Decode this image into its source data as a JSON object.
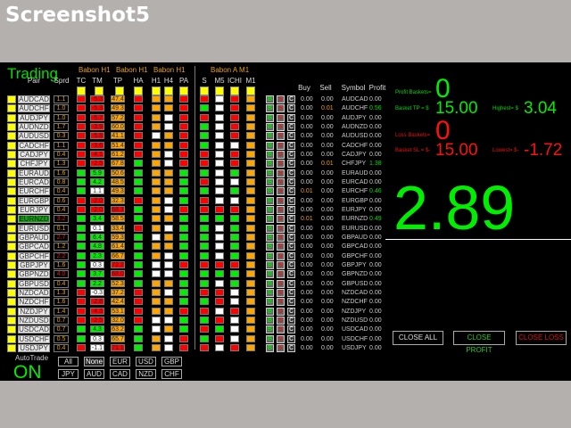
{
  "window_title": "Screenshot5",
  "colors": {
    "red": "#ff0000",
    "orange": "#ffa500",
    "green": "#00ee00",
    "white": "#ffffff",
    "yellow": "#ffff00",
    "accent_green": "#00dd00",
    "loss_red": "#ff1010"
  },
  "trading_label": "Trading",
  "group_headers": [
    "Babon H1",
    "Babon H1",
    "Babon H1",
    "Babon A M1"
  ],
  "columns": {
    "pair": "Pair",
    "sprd": "Sprd",
    "tc": "TC",
    "tm": "TM",
    "tp": "TP",
    "ha": "HA",
    "h1": "H1",
    "h4": "H4",
    "pa": "PA",
    "s": "S",
    "m5": "M5",
    "ichi": "ICHI",
    "m1": "M1",
    "buy": "Buy",
    "sell": "Sell",
    "symbol": "Symbol",
    "profit": "Profit"
  },
  "trade_buttons": {
    "buy": "B",
    "sell": "S",
    "close": "C"
  },
  "rows": [
    {
      "pair": "AUDCAD",
      "sprd": "1.1",
      "sc": "orange",
      "tc": "red",
      "tm": "-5.3",
      "tmc": "red",
      "tp": "47.4",
      "tpc": "orange",
      "sig": [
        "red",
        "orange",
        "orange",
        "red",
        "red",
        "white",
        "red",
        "orange"
      ],
      "buy": "0.00",
      "sell": "0.00",
      "profit": "0.00"
    },
    {
      "pair": "AUDCHF",
      "sprd": "1.0",
      "sc": "orange",
      "tc": "red",
      "tm": "-5.3",
      "tmc": "red",
      "tp": "49.3",
      "tpc": "orange",
      "sig": [
        "red",
        "orange",
        "orange",
        "red",
        "green",
        "white",
        "red",
        "orange"
      ],
      "buy": "0.00",
      "sell": "0.01",
      "profit": "0.56"
    },
    {
      "pair": "AUDJPY",
      "sprd": "1.0",
      "sc": "orange",
      "tc": "red",
      "tm": "-5.7",
      "tmc": "red",
      "tp": "57.2",
      "tpc": "orange",
      "sig": [
        "red",
        "orange",
        "white",
        "red",
        "red",
        "white",
        "red",
        "orange"
      ],
      "buy": "0.00",
      "sell": "0.00",
      "profit": "0.00"
    },
    {
      "pair": "AUDNZD",
      "sprd": "1.7",
      "sc": "orange",
      "tc": "red",
      "tm": "-3.9",
      "tmc": "red",
      "tp": "60.0",
      "tpc": "orange",
      "sig": [
        "red",
        "orange",
        "white",
        "red",
        "green",
        "white",
        "red",
        "orange"
      ],
      "buy": "0.00",
      "sell": "0.00",
      "profit": "0.00"
    },
    {
      "pair": "AUDUSD",
      "sprd": "0.3",
      "sc": "orange",
      "tc": "red",
      "tm": "-5.8",
      "tmc": "red",
      "tp": "41.1",
      "tpc": "orange",
      "sig": [
        "red",
        "white",
        "orange",
        "red",
        "green",
        "white",
        "red",
        "orange"
      ],
      "buy": "0.00",
      "sell": "0.00",
      "profit": "0.00"
    },
    {
      "pair": "CADCHF",
      "sprd": "1.1",
      "sc": "orange",
      "tc": "red",
      "tm": "-3.6",
      "tmc": "red",
      "tp": "51.4",
      "tpc": "orange",
      "sig": [
        "red",
        "orange",
        "orange",
        "red",
        "green",
        "white",
        "white",
        "orange"
      ],
      "buy": "0.00",
      "sell": "0.00",
      "profit": "0.00"
    },
    {
      "pair": "CADJPY",
      "sprd": "0.4",
      "sc": "orange",
      "tc": "red",
      "tm": "-4.1",
      "tmc": "red",
      "tp": "61.2",
      "tpc": "orange",
      "sig": [
        "red",
        "orange",
        "white",
        "red",
        "red",
        "white",
        "red",
        "orange"
      ],
      "buy": "0.00",
      "sell": "0.00",
      "profit": "0.00"
    },
    {
      "pair": "CHFJPY",
      "sprd": "1.3",
      "sc": "orange",
      "tc": "red",
      "tm": "-2.5",
      "tmc": "red",
      "tp": "67.8",
      "tpc": "orange",
      "sig": [
        "green",
        "orange",
        "white",
        "red",
        "red",
        "white",
        "red",
        "orange"
      ],
      "buy": "0.00",
      "sell": "0.01",
      "profit": "1.38"
    },
    {
      "pair": "EURAUD",
      "sprd": "1.6",
      "sc": "orange",
      "tc": "green",
      "tm": "5.9",
      "tmc": "green",
      "tp": "50.6",
      "tpc": "orange",
      "sig": [
        "green",
        "orange",
        "orange",
        "green",
        "green",
        "white",
        "green",
        "orange"
      ],
      "buy": "0.00",
      "sell": "0.00",
      "profit": "0.00"
    },
    {
      "pair": "EURCAD",
      "sprd": "0.8",
      "sc": "orange",
      "tc": "green",
      "tm": "4.2",
      "tmc": "green",
      "tp": "48.5",
      "tpc": "orange",
      "sig": [
        "green",
        "orange",
        "orange",
        "green",
        "red",
        "white",
        "white",
        "orange"
      ],
      "buy": "0.00",
      "sell": "0.00",
      "profit": "0.00"
    },
    {
      "pair": "EURCHF",
      "sprd": "0.4",
      "sc": "orange",
      "tc": "green",
      "tm": "1.1",
      "tmc": "white",
      "tp": "49.3",
      "tpc": "orange",
      "sig": [
        "green",
        "orange",
        "orange",
        "green",
        "green",
        "white",
        "green",
        "orange"
      ],
      "buy": "0.01",
      "sell": "0.00",
      "profit": "0.46"
    },
    {
      "pair": "EURGBP",
      "sprd": "0.6",
      "sc": "orange",
      "tc": "red",
      "tm": "-2.0",
      "tmc": "red",
      "tp": "32.3",
      "tpc": "orange",
      "sig": [
        "red",
        "orange",
        "white",
        "green",
        "red",
        "white",
        "white",
        "orange"
      ],
      "buy": "0.00",
      "sell": "0.00",
      "profit": "0.00"
    },
    {
      "pair": "EURJPY",
      "sprd": "0.4",
      "sc": "orange",
      "tc": "red",
      "tm": "-2.0",
      "tmc": "red",
      "tp": "68.3",
      "tpc": "red",
      "sig": [
        "green",
        "orange",
        "white",
        "red",
        "red",
        "red",
        "red",
        "orange"
      ],
      "buy": "0.00",
      "sell": "0.00",
      "profit": "0.00"
    },
    {
      "pair": "EURNZD",
      "sprd": "3.2",
      "sc": "red",
      "tc": "green",
      "tm": "3.4",
      "tmc": "green",
      "tp": "58.5",
      "tpc": "orange",
      "sig": [
        "green",
        "orange",
        "orange",
        "green",
        "green",
        "green",
        "green",
        "orange"
      ],
      "buy": "0.01",
      "sell": "0.00",
      "profit": "0.49",
      "selected": true
    },
    {
      "pair": "EURUSD",
      "sprd": "0.1",
      "sc": "orange",
      "tc": "green",
      "tm": "0.1",
      "tmc": "white",
      "tp": "33.4",
      "tpc": "orange",
      "sig": [
        "red",
        "orange",
        "white",
        "green",
        "green",
        "white",
        "green",
        "orange"
      ],
      "buy": "0.00",
      "sell": "0.00",
      "profit": "0.00"
    },
    {
      "pair": "GBPAUD",
      "sprd": "2.7",
      "sc": "red",
      "tc": "green",
      "tm": "6.4",
      "tmc": "green",
      "tp": "59.3",
      "tpc": "orange",
      "sig": [
        "green",
        "white",
        "orange",
        "green",
        "green",
        "white",
        "green",
        "orange"
      ],
      "buy": "0.00",
      "sell": "0.00",
      "profit": "0.00"
    },
    {
      "pair": "GBPCAD",
      "sprd": "1.2",
      "sc": "orange",
      "tc": "green",
      "tm": "4.8",
      "tmc": "green",
      "tp": "61.4",
      "tpc": "orange",
      "sig": [
        "green",
        "orange",
        "orange",
        "green",
        "green",
        "white",
        "green",
        "orange"
      ],
      "buy": "0.00",
      "sell": "0.00",
      "profit": "0.00"
    },
    {
      "pair": "GBPCHF",
      "sprd": "2.2",
      "sc": "red",
      "tc": "green",
      "tm": "2.3",
      "tmc": "green",
      "tp": "66.7",
      "tpc": "orange",
      "sig": [
        "green",
        "orange",
        "white",
        "green",
        "green",
        "white",
        "green",
        "orange"
      ],
      "buy": "0.00",
      "sell": "0.00",
      "profit": "0.00"
    },
    {
      "pair": "GBPJPY",
      "sprd": "1.6",
      "sc": "orange",
      "tc": "green",
      "tm": "0.3",
      "tmc": "white",
      "tp": "72.2",
      "tpc": "red",
      "sig": [
        "green",
        "white",
        "white",
        "red",
        "red",
        "red",
        "red",
        "orange"
      ],
      "buy": "0.00",
      "sell": "0.00",
      "profit": "0.00"
    },
    {
      "pair": "GBPNZD",
      "sprd": "4.0",
      "sc": "red",
      "tc": "green",
      "tm": "3.7",
      "tmc": "green",
      "tp": "68.0",
      "tpc": "red",
      "sig": [
        "green",
        "white",
        "white",
        "green",
        "green",
        "green",
        "green",
        "orange"
      ],
      "buy": "0.00",
      "sell": "0.00",
      "profit": "0.00"
    },
    {
      "pair": "GBPUSD",
      "sprd": "0.4",
      "sc": "orange",
      "tc": "green",
      "tm": "2.2",
      "tmc": "green",
      "tp": "52.3",
      "tpc": "orange",
      "sig": [
        "green",
        "orange",
        "orange",
        "green",
        "green",
        "white",
        "green",
        "orange"
      ],
      "buy": "0.00",
      "sell": "0.00",
      "profit": "0.00"
    },
    {
      "pair": "NZDCAD",
      "sprd": "1.3",
      "sc": "orange",
      "tc": "red",
      "tm": "-0.3",
      "tmc": "white",
      "tp": "37.2",
      "tpc": "orange",
      "sig": [
        "red",
        "orange",
        "white",
        "green",
        "red",
        "red",
        "white",
        "orange"
      ],
      "buy": "0.00",
      "sell": "0.00",
      "profit": "0.00"
    },
    {
      "pair": "NZDCHF",
      "sprd": "1.6",
      "sc": "orange",
      "tc": "red",
      "tm": "-2.8",
      "tmc": "red",
      "tp": "42.4",
      "tpc": "orange",
      "sig": [
        "red",
        "orange",
        "orange",
        "green",
        "green",
        "red",
        "white",
        "orange"
      ],
      "buy": "0.00",
      "sell": "0.00",
      "profit": "0.00"
    },
    {
      "pair": "NZDJPY",
      "sprd": "1.4",
      "sc": "orange",
      "tc": "red",
      "tm": "-4.3",
      "tmc": "red",
      "tp": "53.1",
      "tpc": "orange",
      "sig": [
        "red",
        "orange",
        "orange",
        "red",
        "red",
        "white",
        "red",
        "orange"
      ],
      "buy": "0.00",
      "sell": "0.00",
      "profit": "0.00"
    },
    {
      "pair": "NZDUSD",
      "sprd": "0.7",
      "sc": "orange",
      "tc": "red",
      "tm": "-2.5",
      "tmc": "red",
      "tp": "32.0",
      "tpc": "orange",
      "sig": [
        "red",
        "white",
        "white",
        "green",
        "green",
        "red",
        "white",
        "orange"
      ],
      "buy": "0.00",
      "sell": "0.00",
      "profit": "0.00"
    },
    {
      "pair": "USDCAD",
      "sprd": "0.7",
      "sc": "orange",
      "tc": "green",
      "tm": "4.3",
      "tmc": "green",
      "tp": "63.2",
      "tpc": "orange",
      "sig": [
        "green",
        "white",
        "orange",
        "green",
        "red",
        "green",
        "white",
        "orange"
      ],
      "buy": "0.00",
      "sell": "0.00",
      "profit": "0.00"
    },
    {
      "pair": "USDCHF",
      "sprd": "0.5",
      "sc": "orange",
      "tc": "green",
      "tm": "0.3",
      "tmc": "white",
      "tp": "65.7",
      "tpc": "orange",
      "sig": [
        "green",
        "orange",
        "white",
        "red",
        "green",
        "red",
        "white",
        "orange"
      ],
      "buy": "0.00",
      "sell": "0.00",
      "profit": "0.00"
    },
    {
      "pair": "USDJPY",
      "sprd": "0.4",
      "sc": "orange",
      "tc": "red",
      "tm": "-1.1",
      "tmc": "white",
      "tp": "71.1",
      "tpc": "red",
      "sig": [
        "green",
        "orange",
        "white",
        "red",
        "red",
        "white",
        "red",
        "orange"
      ],
      "buy": "0.00",
      "sell": "0.00",
      "profit": "0.00"
    }
  ],
  "summary": {
    "profit_baskets_label": "Profit Baskets=",
    "profit_baskets": "0",
    "basket_tp_label": "Basket TP = $",
    "basket_tp": "15.00",
    "highest_label": "Highest= $",
    "highest": "3.04",
    "loss_baskets_label": "Loss Baskets=",
    "loss_baskets": "0",
    "basket_sl_label": "Basket SL = $-",
    "basket_sl": "15.00",
    "lowest_label": "Lowest= $-",
    "lowest": "-1.72",
    "total_profit": "2.89"
  },
  "actions": {
    "close_all": "CLOSE ALL",
    "close_profit": "CLOSE PROFIT",
    "close_loss": "CLOSE LOSS"
  },
  "autotrade": {
    "label": "AutoTrade",
    "state": "ON"
  },
  "filters": [
    [
      "All",
      "None",
      "EUR",
      "USD",
      "GBP"
    ],
    [
      "JPY",
      "AUD",
      "CAD",
      "NZD",
      "CHF"
    ]
  ]
}
